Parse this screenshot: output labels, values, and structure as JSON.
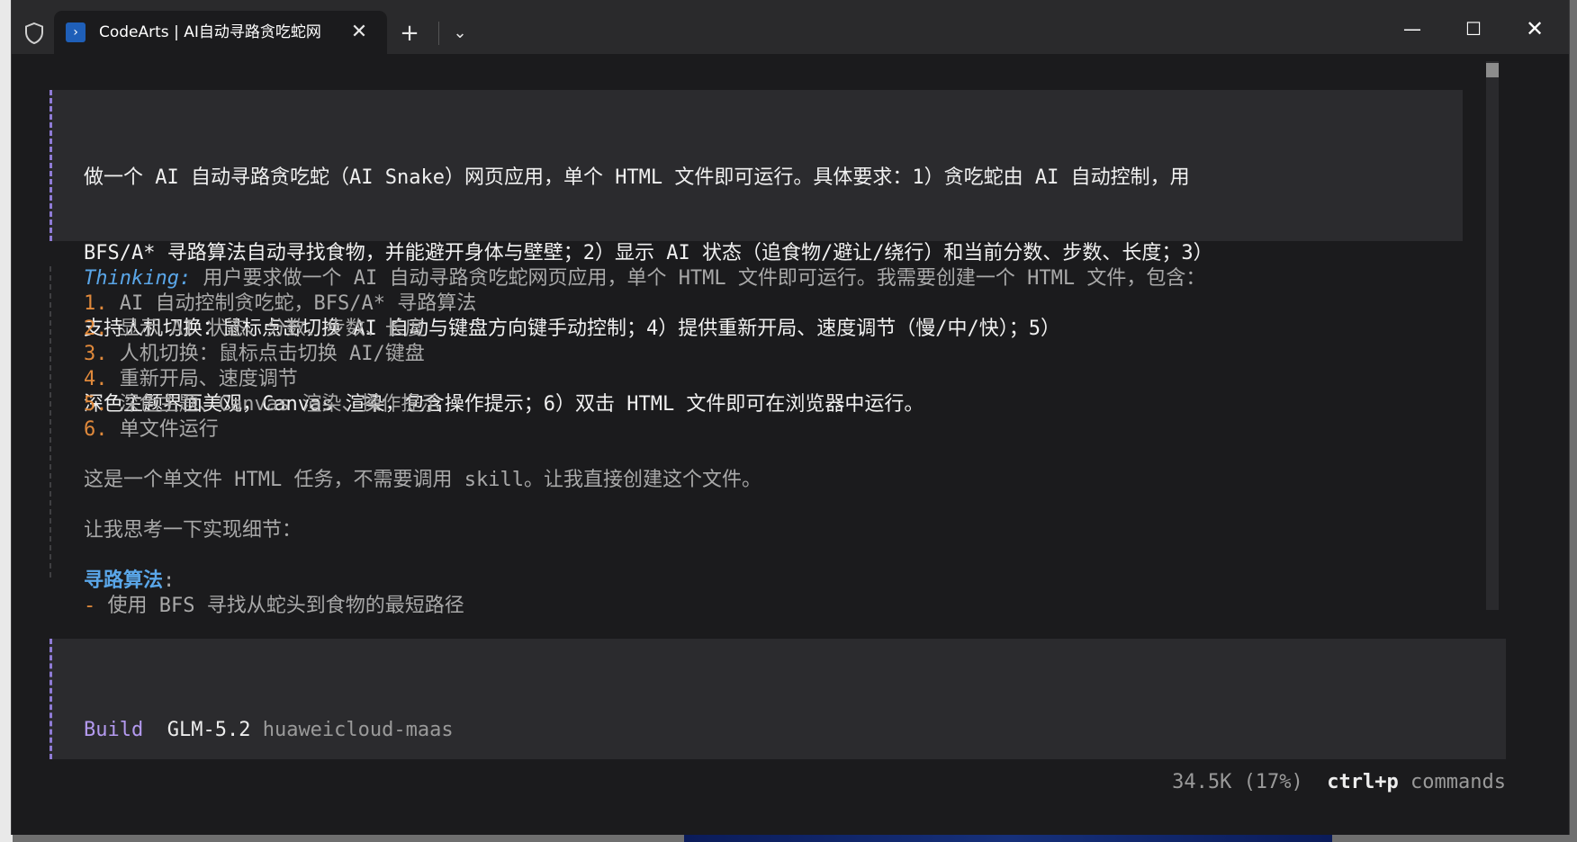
{
  "window": {
    "tab_title": "CodeArts | AI自动寻路贪吃蛇网",
    "tab_close": "✕",
    "new_tab": "+",
    "tab_dropdown": "⌄",
    "minimize": "—",
    "maximize": "☐",
    "close": "✕"
  },
  "prompt": {
    "lines": [
      "做一个 AI 自动寻路贪吃蛇（AI Snake）网页应用，单个 HTML 文件即可运行。具体要求：1）贪吃蛇由 AI 自动控制，用",
      "BFS/A* 寻路算法自动寻找食物，并能避开身体与壁壁；2）显示 AI 状态（追食物/避让/绕行）和当前分数、步数、长度；3）",
      "支持人机切换：鼠标点击切换 AI 自动与键盘方向键手动控制；4）提供重新开局、速度调节（慢/中/快）；5）",
      "深色主题界面美观，Canvas 渲染，包含操作提示；6）双击 HTML 文件即可在浏览器中运行。"
    ]
  },
  "thinking": {
    "label": "Thinking:",
    "intro": " 用户要求做一个 AI 自动寻路贪吃蛇网页应用，单个 HTML 文件即可运行。我需要创建一个 HTML 文件，包含：",
    "items": [
      {
        "num": "1.",
        "text": " AI 自动控制贪吃蛇，BFS/A* 寻路算法"
      },
      {
        "num": "2.",
        "text": " 显示 AI 状态、分数、步数、长度"
      },
      {
        "num": "3.",
        "text": " 人机切换：鼠标点击切换 AI/键盘"
      },
      {
        "num": "4.",
        "text": " 重新开局、速度调节"
      },
      {
        "num": "5.",
        "text": " 深色主题、Canvas 渲染、操作提示"
      },
      {
        "num": "6.",
        "text": " 单文件运行"
      }
    ],
    "para1": "这是一个单文件 HTML 任务，不需要调用 skill。让我直接创建这个文件。",
    "para2": "让我思考一下实现细节：",
    "section_title": "寻路算法",
    "section_colon": ":",
    "bullet_dash": "-",
    "bullet_text": " 使用 BFS 寻找从蛇头到食物的最短路径"
  },
  "input": {
    "mode": "Build",
    "model": "GLM-5.2",
    "provider": "huaweicloud-maas"
  },
  "status": {
    "tokens": "34.5K (17%)",
    "shortcut": "ctrl+p",
    "shortcut_label": "commands"
  },
  "colors": {
    "accent_purple": "#b49af0",
    "thinking_blue": "#5aa6e8",
    "number_orange": "#e0893b",
    "background": "#1b1b1d"
  }
}
